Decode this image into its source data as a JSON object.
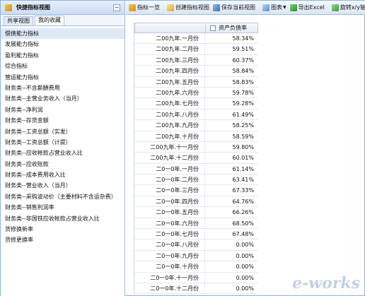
{
  "sidebar": {
    "title": "快捷指标视图",
    "collapse_icon": "minus-icon",
    "tabs": [
      "共享视图",
      "我的收藏"
    ],
    "active_tab": 1,
    "items": [
      "偿债能力指标",
      "发展能力指标",
      "盈利能力指标",
      "综合指标",
      "营运能力指标",
      "财务类--不含薪酬费用",
      "财务类--主营业务收入（当月）",
      "财务类--净利润",
      "财务类--存货金额",
      "财务类--工资总额（实发）",
      "财务类--工资总额（计提）",
      "财务类--应收帐款占营业收入比",
      "财务类--应收账款",
      "财务类--成本费用收入比",
      "财务类--营业收入（当月）",
      "财务类--采购波动价（主要材料不含运杂费）",
      "财务类--销售利润率",
      "财务类--非国铁应收帐款占营业收入比",
      "货修换新率",
      "货修更换率"
    ],
    "selected_index": 0
  },
  "toolbar": {
    "indicator_list": "指标一览",
    "create_view": "创建指标视图",
    "save_view": "保存当前视图",
    "chart": "图表",
    "export_excel": "导出Excel",
    "rotate": "旋转x/y轴"
  },
  "grid": {
    "column_header": "资产负债率",
    "rows": [
      {
        "period": "二00九年.一月份",
        "value": "58.34%"
      },
      {
        "period": "二00九年.二月份",
        "value": "59.51%"
      },
      {
        "period": "二00九年.三月份",
        "value": "60.37%"
      },
      {
        "period": "二00九年.四月份",
        "value": "58.84%"
      },
      {
        "period": "二00九年.五月份",
        "value": "58.83%"
      },
      {
        "period": "二00九年.六月份",
        "value": "59.78%"
      },
      {
        "period": "二00九年.七月份",
        "value": "59.28%"
      },
      {
        "period": "二00九年.八月份",
        "value": "61.49%"
      },
      {
        "period": "二00九年.九月份",
        "value": "58.25%"
      },
      {
        "period": "二00九年.十月份",
        "value": "58.59%"
      },
      {
        "period": "二00九年.十一月份",
        "value": "59.80%"
      },
      {
        "period": "二00九年.十二月份",
        "value": "60.01%"
      },
      {
        "period": "二0一0年.一月份",
        "value": "61.14%"
      },
      {
        "period": "二0一0年.二月份",
        "value": "63.41%"
      },
      {
        "period": "二0一0年.三月份",
        "value": "67.33%"
      },
      {
        "period": "二0一0年.四月份",
        "value": "64.76%"
      },
      {
        "period": "二0一0年.五月份",
        "value": "66.26%"
      },
      {
        "period": "二0一0年.六月份",
        "value": "68.50%"
      },
      {
        "period": "二0一0年.七月份",
        "value": "67.48%"
      },
      {
        "period": "二0一0年.八月份",
        "value": "0.00%"
      },
      {
        "period": "二0一0年.九月份",
        "value": "0.00%"
      },
      {
        "period": "二0一0年.十月份",
        "value": "0.00%"
      },
      {
        "period": "二0一0年.十一月份",
        "value": "0.00%"
      },
      {
        "period": "二0一0年.十二月份",
        "value": "0.00%"
      }
    ]
  },
  "watermark": "e-works"
}
